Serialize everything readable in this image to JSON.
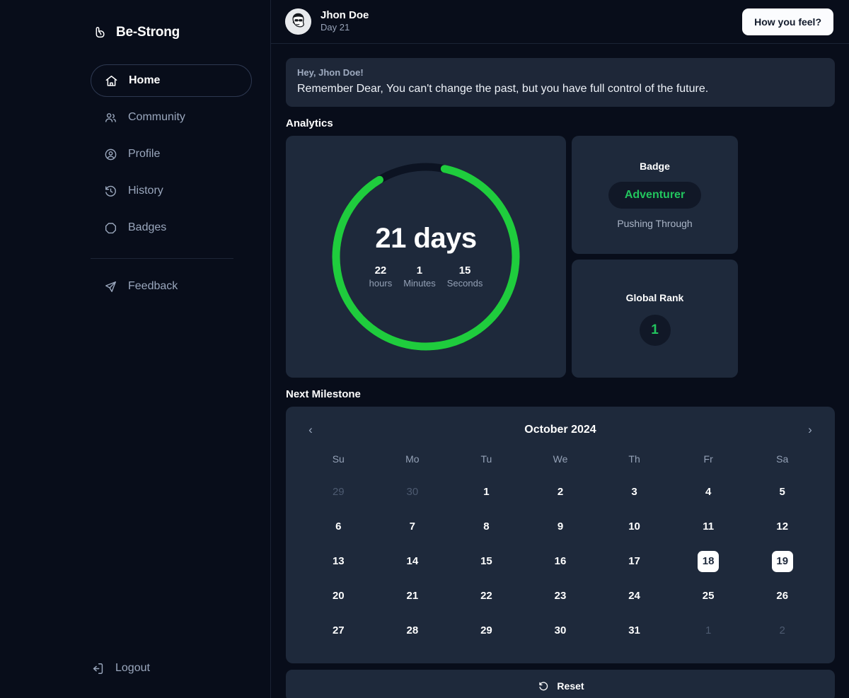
{
  "brand": {
    "name": "Be-Strong",
    "logo_icon": "bicep-flex-icon"
  },
  "sidebar": {
    "items": [
      {
        "label": "Home",
        "icon": "home-icon",
        "active": true
      },
      {
        "label": "Community",
        "icon": "users-icon",
        "active": false
      },
      {
        "label": "Profile",
        "icon": "user-circle-icon",
        "active": false
      },
      {
        "label": "History",
        "icon": "history-icon",
        "active": false
      },
      {
        "label": "Badges",
        "icon": "octagon-icon",
        "active": false
      }
    ],
    "secondary": [
      {
        "label": "Feedback",
        "icon": "send-icon"
      }
    ],
    "logout": {
      "label": "Logout",
      "icon": "logout-icon"
    }
  },
  "header": {
    "user_name": "Jhon Doe",
    "user_day": "Day 21",
    "avatar_icon": "user-avatar-sunglasses",
    "feel_button": "How you feel?"
  },
  "greeting": {
    "salutation": "Hey, Jhon Doe!",
    "message": "Remember Dear, You can't change the past, but you have full control of the future."
  },
  "sections": {
    "analytics_title": "Analytics",
    "milestone_title": "Next Milestone"
  },
  "progress": {
    "days_label": "21 days",
    "percent": 88,
    "counters": [
      {
        "value": "22",
        "label": "hours"
      },
      {
        "value": "1",
        "label": "Minutes"
      },
      {
        "value": "15",
        "label": "Seconds"
      }
    ]
  },
  "badge": {
    "title": "Badge",
    "name": "Adventurer",
    "subtitle": "Pushing Through"
  },
  "rank": {
    "title": "Global Rank",
    "value": "1"
  },
  "calendar": {
    "month": "October 2024",
    "prev_icon": "chevron-left-icon",
    "next_icon": "chevron-right-icon",
    "weekdays": [
      "Su",
      "Mo",
      "Tu",
      "We",
      "Th",
      "Fr",
      "Sa"
    ],
    "weeks": [
      [
        {
          "d": "29",
          "muted": true
        },
        {
          "d": "30",
          "muted": true
        },
        {
          "d": "1"
        },
        {
          "d": "2"
        },
        {
          "d": "3"
        },
        {
          "d": "4"
        },
        {
          "d": "5"
        }
      ],
      [
        {
          "d": "6"
        },
        {
          "d": "7"
        },
        {
          "d": "8"
        },
        {
          "d": "9"
        },
        {
          "d": "10"
        },
        {
          "d": "11"
        },
        {
          "d": "12"
        }
      ],
      [
        {
          "d": "13"
        },
        {
          "d": "14"
        },
        {
          "d": "15"
        },
        {
          "d": "16"
        },
        {
          "d": "17"
        },
        {
          "d": "18",
          "selected": true
        },
        {
          "d": "19",
          "selected": true
        }
      ],
      [
        {
          "d": "20"
        },
        {
          "d": "21"
        },
        {
          "d": "22"
        },
        {
          "d": "23"
        },
        {
          "d": "24"
        },
        {
          "d": "25"
        },
        {
          "d": "26"
        }
      ],
      [
        {
          "d": "27"
        },
        {
          "d": "28"
        },
        {
          "d": "29"
        },
        {
          "d": "30"
        },
        {
          "d": "31"
        },
        {
          "d": "1",
          "muted": true
        },
        {
          "d": "2",
          "muted": true
        }
      ]
    ]
  },
  "reset": {
    "label": "Reset",
    "icon": "rotate-ccw-icon"
  },
  "colors": {
    "accent_green": "#22c55e",
    "page_bg": "#080d1a",
    "card_bg": "#1e293b",
    "banner_bg": "#1e2738"
  }
}
